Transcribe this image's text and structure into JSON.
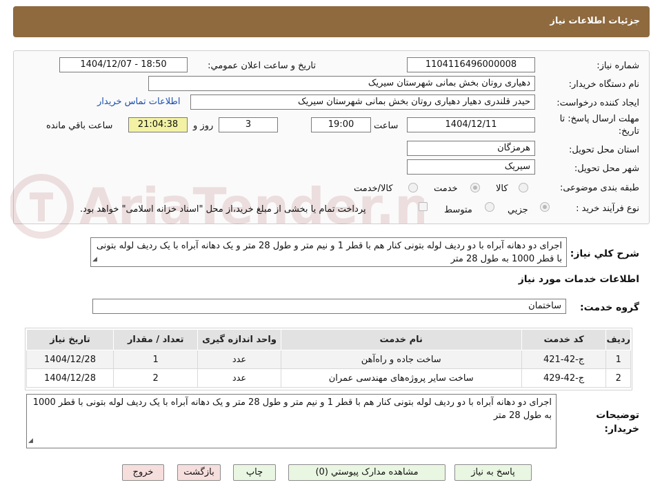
{
  "header": {
    "title": "جزئیات اطلاعات نیاز"
  },
  "form": {
    "need_number": {
      "label": "شماره نیاز:",
      "value": "1104116496000008"
    },
    "announce_datetime": {
      "label": "تاریخ و ساعت اعلان عمومي:",
      "value": "1404/12/07 - 18:50"
    },
    "buyer_org": {
      "label": "نام دستگاه خريدار:",
      "value": "دهیاری روتان بخش بمانی شهرستان سیریک"
    },
    "requester": {
      "label": "ايجاد کننده درخواست:",
      "value": "حیدر قلندری دهیار دهیاری روتان بخش بمانی شهرستان سیریک"
    },
    "contact_link": "اطلاعات تماس خريدار",
    "deadline": {
      "label": "مهلت ارسال پاسخ: تا تاریخ:",
      "date": "1404/12/11",
      "time_label": "ساعت",
      "time": "19:00",
      "days": "3",
      "days_label": "روز و",
      "remaining": "21:04:38",
      "remaining_label": "ساعت باقي مانده"
    },
    "province": {
      "label": "استان محل تحويل:",
      "value": "هرمزگان"
    },
    "city": {
      "label": "شهر محل تحويل:",
      "value": "سیریک"
    },
    "category": {
      "label": "طبقه بندی موضوعی:",
      "options": [
        "کالا",
        "خدمت",
        "کالا/خدمت"
      ],
      "selected": "خدمت"
    },
    "process_type": {
      "label": "نوع فرآیند خرید :",
      "options": [
        "جزيي",
        "متوسط"
      ],
      "selected": "جزيي",
      "treasury_note": "پرداخت تمام یا بخشی از مبلغ خرید،از محل \"اسناد خزانه اسلامی\" خواهد بود."
    }
  },
  "summary": {
    "label": "شرح کلي نياز:",
    "text": "اجرای دو دهانه آبراه با دو ردیف لوله بتونی کنار هم با قطر 1 و نیم متر و طول 28 متر و یک دهانه آبراه با یک ردیف لوله بتونی با قطر 1000 به طول 28 متر"
  },
  "services": {
    "section_title": "اطلاعات خدمات مورد نياز",
    "group_label": "گروه خدمت:",
    "group_value": "ساختمان",
    "columns": [
      "رديف",
      "کد خدمت",
      "نام خدمت",
      "واحد اندازه گيری",
      "تعداد / مقدار",
      "تاریخ نیاز"
    ],
    "rows": [
      [
        "1",
        "ج-42-421",
        "ساخت جاده و راه‌آهن",
        "عدد",
        "1",
        "1404/12/28"
      ],
      [
        "2",
        "ج-42-429",
        "ساخت سایر پروژه‌های مهندسی عمران",
        "عدد",
        "2",
        "1404/12/28"
      ]
    ]
  },
  "buyer_notes": {
    "label": "توضيحات خريدار:",
    "text": "اجرای دو دهانه آبراه با دو ردیف لوله بتونی کنار هم با قطر 1 و نیم متر و طول 28 متر و یک دهانه آبراه با یک ردیف لوله بتونی با قطر 1000 به طول 28 متر"
  },
  "buttons": {
    "respond": "پاسخ به نياز",
    "attachments": "مشاهده مدارک پيوستي (0)",
    "print": "چاپ",
    "back": "بازگشت",
    "exit": "خروج"
  },
  "watermark": "AriaTender.neT",
  "colors": {
    "header": "#8e6a3e",
    "timer": "#f3f2a4",
    "link": "#1a4fb0",
    "btn_green": "#e9f6e2",
    "btn_pink": "#f6dedd"
  }
}
